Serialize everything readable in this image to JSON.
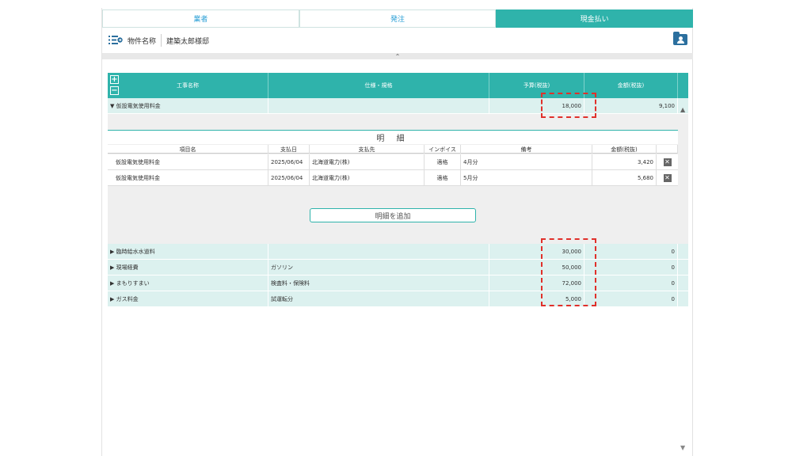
{
  "tabs": [
    {
      "label": "業者",
      "active": false
    },
    {
      "label": "発注",
      "active": false
    },
    {
      "label": "現金払い",
      "active": true
    }
  ],
  "property": {
    "label": "物件名称",
    "value": "建築太郎様邸"
  },
  "collapse_icon": "chevron-up-icon",
  "table": {
    "headers": {
      "name": "工事名称",
      "spec": "仕様・規格",
      "budget": "予算(税抜)",
      "amount": "金額(税抜)"
    },
    "expand_label": "+",
    "collapse_label": "−",
    "expanded_row": {
      "toggle": "▼",
      "name": "仮設電気使用料金",
      "spec": "",
      "budget": "18,000",
      "amount": "9,100"
    },
    "detail": {
      "title": "明 細",
      "headers": {
        "item": "項目名",
        "date": "支払日",
        "payee": "支払先",
        "invoice": "インボイス",
        "note": "備考",
        "amount": "金額(税抜)"
      },
      "rows": [
        {
          "item": "仮設電気使用料金",
          "date": "2025/06/04",
          "payee": "北海道電力(株)",
          "invoice": "適格",
          "note": "4月分",
          "amount": "3,420"
        },
        {
          "item": "仮設電気使用料金",
          "date": "2025/06/04",
          "payee": "北海道電力(株)",
          "invoice": "適格",
          "note": "5月分",
          "amount": "5,680"
        }
      ],
      "add_label": "明細を追加",
      "delete_label": "✕"
    },
    "rows": [
      {
        "toggle": "▶",
        "name": "臨時給水水道料",
        "spec": "",
        "budget": "30,000",
        "amount": "0"
      },
      {
        "toggle": "▶",
        "name": "現場経費",
        "spec": "ガソリン",
        "budget": "50,000",
        "amount": "0"
      },
      {
        "toggle": "▶",
        "name": "まもりすまい",
        "spec": "検査料・保険料",
        "budget": "72,000",
        "amount": "0"
      },
      {
        "toggle": "▶",
        "name": "ガス料金",
        "spec": "試運転分",
        "budget": "5,000",
        "amount": "0"
      }
    ]
  },
  "scroll": {
    "up": "▲",
    "down": "▼",
    "collapse_arrow": "⌃"
  },
  "colors": {
    "accent": "#2fb3ab",
    "row_bg": "#dcf1ef",
    "highlight": "#e0302a",
    "tab_text": "#2a9fd6"
  }
}
